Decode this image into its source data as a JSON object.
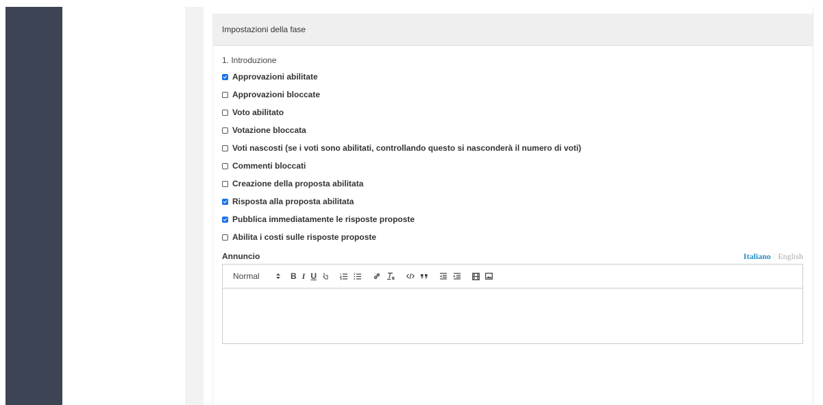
{
  "panel": {
    "title": "Impostazioni della fase",
    "step_label": "1. Introduzione"
  },
  "options": [
    {
      "label": "Approvazioni abilitate",
      "checked": true
    },
    {
      "label": "Approvazioni bloccate",
      "checked": false
    },
    {
      "label": "Voto abilitato",
      "checked": false
    },
    {
      "label": "Votazione bloccata",
      "checked": false
    },
    {
      "label": "Voti nascosti (se i voti sono abilitati, controllando questo si nasconderà il numero di voti)",
      "checked": false
    },
    {
      "label": "Commenti bloccati",
      "checked": false
    },
    {
      "label": "Creazione della proposta abilitata",
      "checked": false
    },
    {
      "label": "Risposta alla proposta abilitata",
      "checked": true
    },
    {
      "label": "Pubblica immediatamente le risposte proposte",
      "checked": true
    },
    {
      "label": "Abilita i costi sulle risposte proposte",
      "checked": false
    }
  ],
  "announcement": {
    "label": "Annuncio",
    "lang_active": "Italiano",
    "lang_separator": "|",
    "lang_other": "English"
  },
  "toolbar": {
    "heading_value": "Normal",
    "bold": "B",
    "italic": "I",
    "underline": "U"
  },
  "colors": {
    "sidebar": "#3d4454",
    "accent": "#2a8fc8",
    "checkbox_checked": "#1a73e8"
  }
}
